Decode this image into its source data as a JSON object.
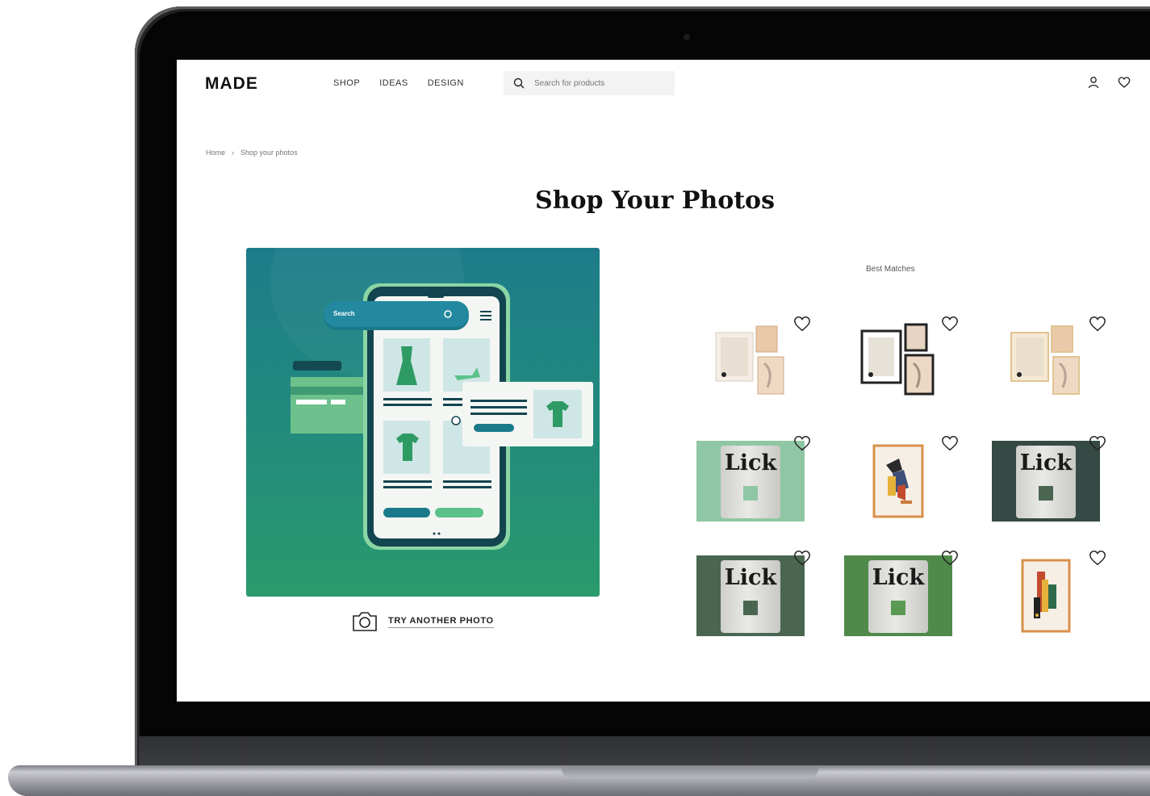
{
  "header": {
    "logo": "MADE",
    "nav": [
      "SHOP",
      "IDEAS",
      "DESIGN"
    ],
    "search_placeholder": "Search for products",
    "icons": [
      "account-icon",
      "heart-icon"
    ]
  },
  "breadcrumb": [
    "Home",
    "Shop your photos"
  ],
  "page_title": "Shop Your Photos",
  "hero": {
    "search_label": "Search",
    "try_another_label": "TRY ANOTHER PHOTO"
  },
  "results": {
    "heading": "Best Matches",
    "products": [
      {
        "type": "frames-set",
        "style": "light"
      },
      {
        "type": "frames-set",
        "style": "dark"
      },
      {
        "type": "frames-set",
        "style": "light"
      },
      {
        "type": "lick-tin",
        "brand_text": "Lick",
        "background": "#8fc7a4"
      },
      {
        "type": "abstract-print",
        "style": "orange-frame"
      },
      {
        "type": "lick-tin",
        "brand_text": "Lick",
        "background": "#354a44"
      },
      {
        "type": "lick-tin",
        "brand_text": "Lick",
        "background": "#4a6650"
      },
      {
        "type": "lick-tin",
        "brand_text": "Lick",
        "background": "#4f8a4a"
      },
      {
        "type": "abstract-print",
        "style": "orange-frame-2"
      }
    ]
  },
  "colors": {
    "hero_teal": "#1e7c8a",
    "hero_green": "#2a9a6c",
    "text_dark": "#111111"
  }
}
